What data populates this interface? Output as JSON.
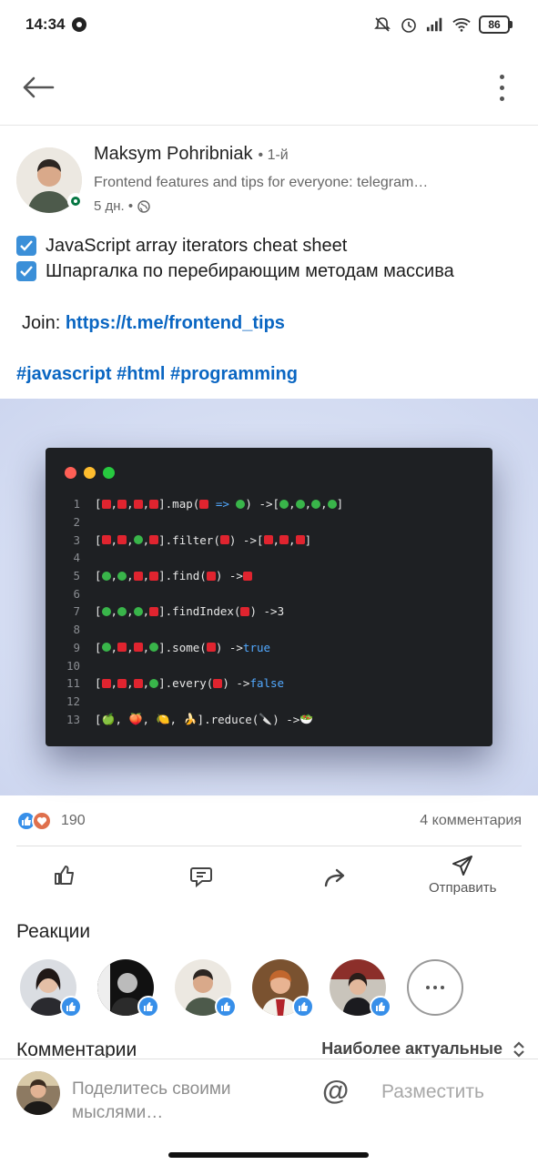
{
  "status_bar": {
    "time": "14:34",
    "battery": "86",
    "icons": [
      "mute-icon",
      "alarm-icon",
      "signal-icon",
      "wifi-icon",
      "battery-icon"
    ]
  },
  "app_bar": {
    "back_icon": "arrow-left-icon",
    "more_icon": "more-vertical-icon"
  },
  "post": {
    "author": {
      "name": "Maksym Pohribniak",
      "degree": "• 1-й",
      "headline": "Frontend features and tips for everyone: telegram…",
      "time": "5 дн. •",
      "visibility_icon": "globe-icon"
    },
    "text": {
      "line1": "JavaScript array iterators cheat sheet",
      "line2": "Шпаргалка по перебирающим методам массива",
      "join_label": "Join:",
      "join_link": "https://t.me/frontend_tips",
      "tags": "#javascript #html #programming"
    },
    "code_image": {
      "window_dots": [
        "#ff5f56",
        "#ffbd2e",
        "#27c93f"
      ],
      "line_numbers": [
        "1",
        "2",
        "3",
        "4",
        "5",
        "6",
        "7",
        "8",
        "9",
        "10",
        "11",
        "12",
        "13"
      ],
      "snippets": {
        "map": ".map(",
        "arrow_fn": "=>",
        "arrow": ") -> ",
        "filter": ".filter(",
        "find": ".find(",
        "findIndex": ".findIndex(",
        "findIndex_result": "3",
        "some": ".some(",
        "some_result": "true",
        "every": ".every(",
        "every_result": "false",
        "reduce": ".reduce(",
        "fruits": [
          "🍏",
          "🍑",
          "🍋",
          "🍌"
        ],
        "knife": "🔪",
        "salad": "🥗"
      }
    },
    "social": {
      "reaction_count": "190",
      "comment_count": "4 комментария"
    },
    "actions": {
      "like_icon": "thumbs-up-icon",
      "comment_icon": "comment-icon",
      "share_icon": "share-icon",
      "send_label": "Отправить",
      "send_icon": "send-icon"
    },
    "reactions": {
      "title": "Реакции",
      "reactors": [
        "reactor-1",
        "reactor-2",
        "reactor-3",
        "reactor-4",
        "reactor-5"
      ]
    },
    "comments": {
      "title": "Комментарии",
      "sort_label": "Наиболее актуальные"
    }
  },
  "composer": {
    "placeholder_line1": "Поделитесь своими",
    "placeholder_line2": "мыслями…",
    "mention": "@",
    "post_label": "Разместить"
  },
  "colors": {
    "link": "#0a66c2",
    "online": "#057642",
    "like": "#378fe9",
    "love": "#df704d",
    "code_bg": "#1e2023",
    "keyword": "#52a9ff"
  }
}
